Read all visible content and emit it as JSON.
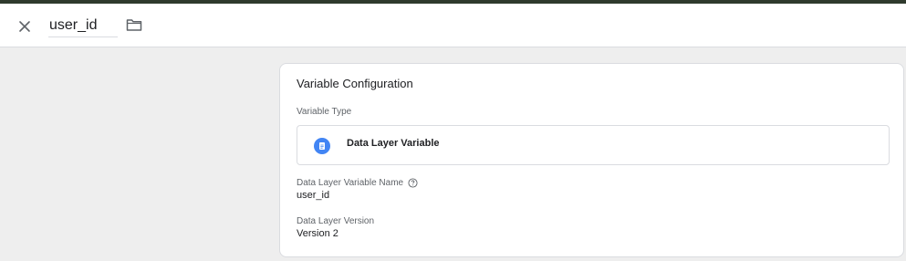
{
  "header": {
    "variable_name": "user_id",
    "icons": {
      "close": "close-icon",
      "folder": "folder-icon"
    }
  },
  "card": {
    "title": "Variable Configuration",
    "variable_type_label": "Variable Type",
    "variable_type": {
      "name": "Data Layer Variable",
      "icon": "document-icon",
      "icon_color": "#4285f4"
    },
    "fields": [
      {
        "label": "Data Layer Variable Name",
        "value": "user_id",
        "help_icon": "help-icon"
      },
      {
        "label": "Data Layer Version",
        "value": "Version 2"
      }
    ]
  },
  "colors": {
    "top_strip": "#2f3a2d",
    "background": "#eeeeee",
    "card": "#ffffff",
    "border": "#dadce0",
    "accent": "#4285f4"
  }
}
